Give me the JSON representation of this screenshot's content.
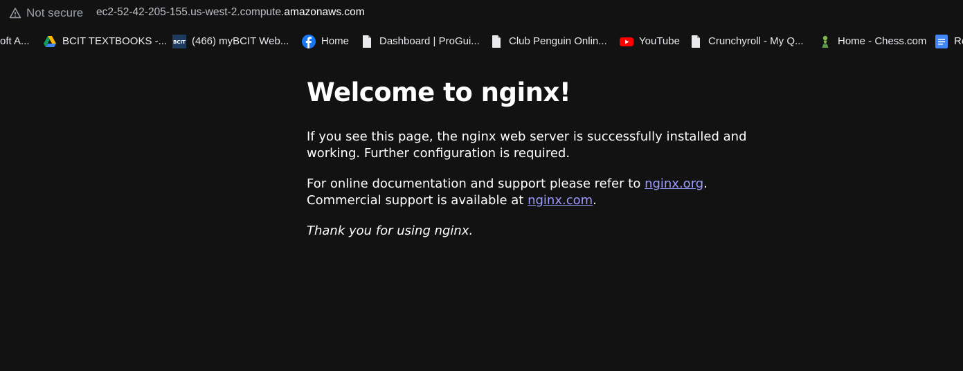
{
  "addressbar": {
    "security_label": "Not secure",
    "url_prefix": "ec2-52-42-205-155.us-west-2.compute.",
    "url_domain": "amazonaws.com"
  },
  "bookmarks": [
    {
      "label": "oft A...",
      "icon": "microsoft-icon"
    },
    {
      "label": "BCIT TEXTBOOKS -...",
      "icon": "google-drive-icon"
    },
    {
      "label": "(466) myBCIT Web...",
      "icon": "bcit-icon",
      "icon_text": "BCIT"
    },
    {
      "label": "Home",
      "icon": "facebook-icon"
    },
    {
      "label": "Dashboard | ProGui...",
      "icon": "page-icon"
    },
    {
      "label": "Club Penguin Onlin...",
      "icon": "page-icon"
    },
    {
      "label": "YouTube",
      "icon": "youtube-icon"
    },
    {
      "label": "Crunchyroll - My Q...",
      "icon": "page-icon"
    },
    {
      "label": "Home - Chess.com",
      "icon": "chess-pawn-icon"
    },
    {
      "label": "Re",
      "icon": "google-docs-icon"
    }
  ],
  "page": {
    "title": "Welcome to nginx!",
    "p1": "If you see this page, the nginx web server is successfully installed and working. Further configuration is required.",
    "p2_text1": "For online documentation and support please refer to ",
    "p2_link1": "nginx.org",
    "p2_text2": ".",
    "p2_text3": "Commercial support is available at ",
    "p2_link2": "nginx.com",
    "p2_text4": ".",
    "p3": "Thank you for using nginx."
  },
  "colors": {
    "background": "#121212",
    "link": "#9b9bff",
    "text": "#ffffff"
  }
}
